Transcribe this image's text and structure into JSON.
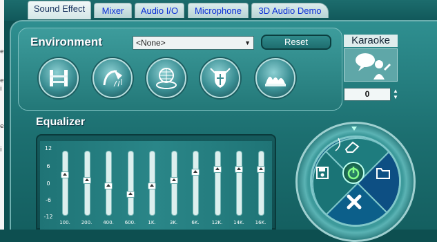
{
  "tabs": [
    {
      "label": "Sound Effect",
      "active": true
    },
    {
      "label": "Mixer"
    },
    {
      "label": "Audio I/O"
    },
    {
      "label": "Microphone"
    },
    {
      "label": "3D Audio Demo"
    }
  ],
  "environment": {
    "title": "Environment",
    "selected": "<None>",
    "reset_label": "Reset",
    "presets": [
      {
        "icon": "bathroom-icon"
      },
      {
        "icon": "shower-icon"
      },
      {
        "icon": "stadium-icon"
      },
      {
        "icon": "shield-swords-icon"
      },
      {
        "icon": "opera-house-icon"
      }
    ]
  },
  "karaoke": {
    "title": "Karaoke",
    "value": "0"
  },
  "equalizer": {
    "title": "Equalizer",
    "y_ticks": [
      "12",
      "6",
      "0",
      "-6",
      "-12"
    ],
    "bands": [
      {
        "label": "100.",
        "level": 3
      },
      {
        "label": "200.",
        "level": 1
      },
      {
        "label": "400.",
        "level": -1
      },
      {
        "label": "600.",
        "level": -4
      },
      {
        "label": "1K.",
        "level": -1
      },
      {
        "label": "3K.",
        "level": 1
      },
      {
        "label": "6K.",
        "level": 4
      },
      {
        "label": "12K.",
        "level": 5
      },
      {
        "label": "14K.",
        "level": 5
      },
      {
        "label": "16K.",
        "level": 5
      }
    ]
  },
  "page_strip_chars": [
    "e",
    "e",
    "i",
    "e",
    "i"
  ]
}
